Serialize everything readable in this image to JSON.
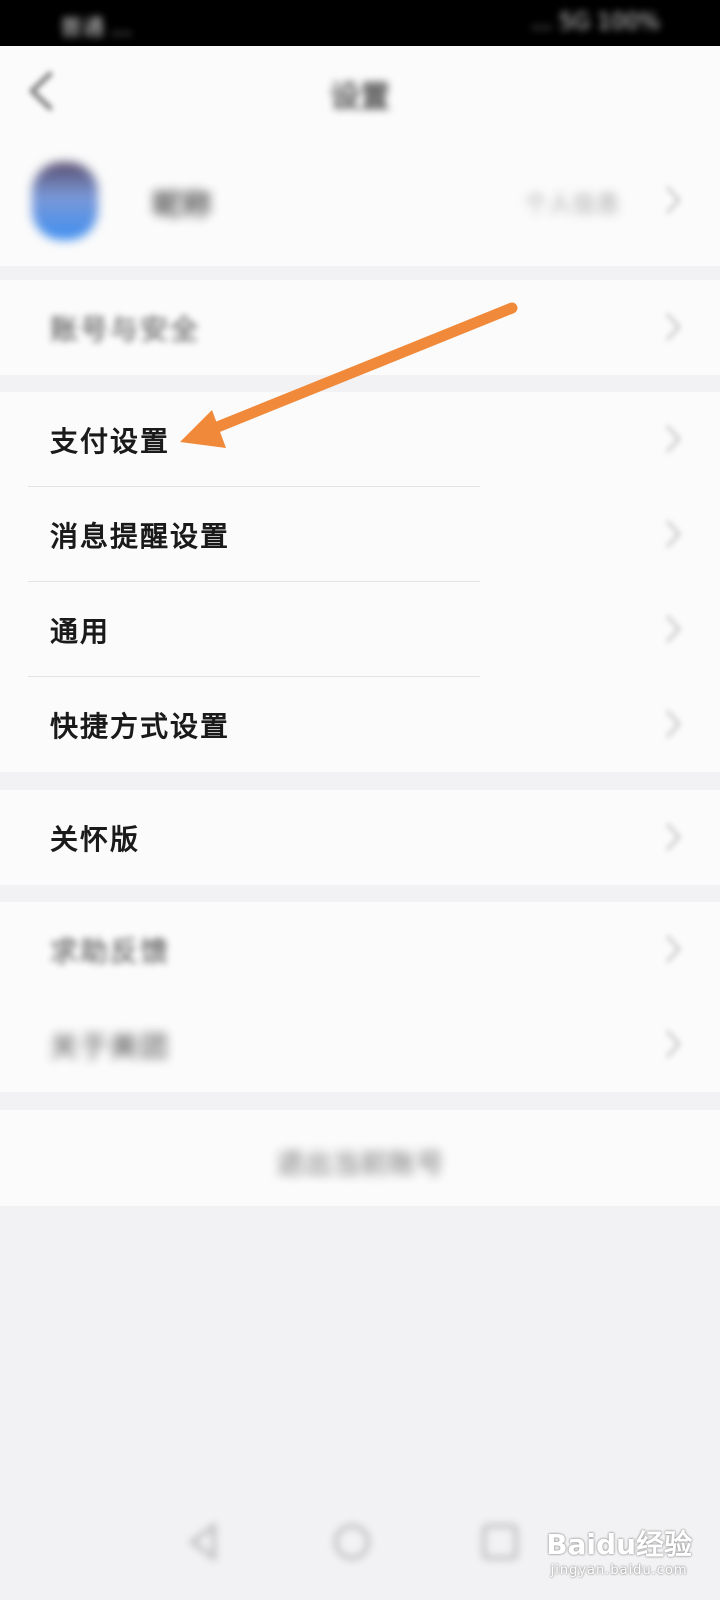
{
  "status_bar": {
    "left": "普通 ...",
    "right": "... 5G 100%"
  },
  "header": {
    "title": "设置"
  },
  "profile": {
    "name": "昵称",
    "right_text": "个人信息"
  },
  "groups": [
    {
      "items": [
        {
          "label": "账号与安全"
        }
      ]
    },
    {
      "items": [
        {
          "label": "支付设置"
        },
        {
          "label": "消息提醒设置"
        },
        {
          "label": "通用"
        },
        {
          "label": "快捷方式设置"
        }
      ]
    },
    {
      "items": [
        {
          "label": "关怀版"
        }
      ]
    },
    {
      "items": [
        {
          "label": "求助反馈"
        },
        {
          "label": "关于美团"
        }
      ]
    }
  ],
  "logout": {
    "label": "退出当前账号"
  },
  "watermark": {
    "main": "Baidu经验",
    "sub": "jingyan.baidu.com"
  },
  "colors": {
    "arrow": "#f08a3a",
    "background": "#f2f2f4",
    "card": "#fbfbfb"
  }
}
